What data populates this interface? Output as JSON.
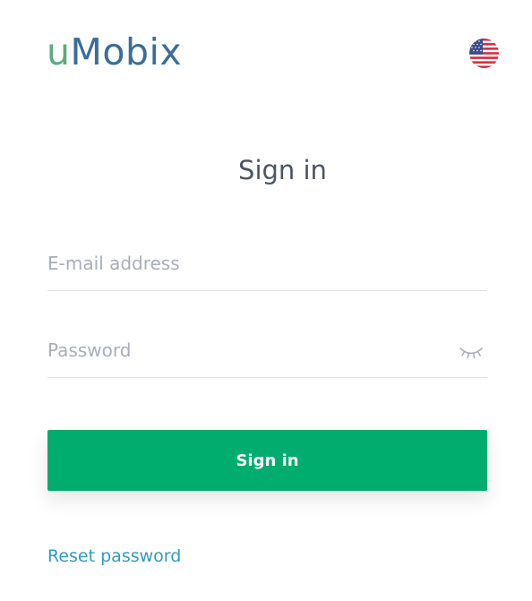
{
  "brand": {
    "logo_first": "u",
    "logo_rest": "Mobix",
    "colors": {
      "u": "#5aab82",
      "rest": "#3b6d98"
    }
  },
  "language": {
    "icon": "us-flag-icon"
  },
  "form": {
    "title": "Sign in",
    "email_placeholder": "E-mail address",
    "email_value": "",
    "password_placeholder": "Password",
    "password_value": "",
    "password_toggle_icon": "eye-closed-icon",
    "submit_label": "Sign in",
    "reset_label": "Reset password"
  },
  "colors": {
    "primary": "#00ad6f",
    "link": "#2f9bc2",
    "placeholder": "#a8aebb",
    "divider": "#dcdfe4"
  }
}
